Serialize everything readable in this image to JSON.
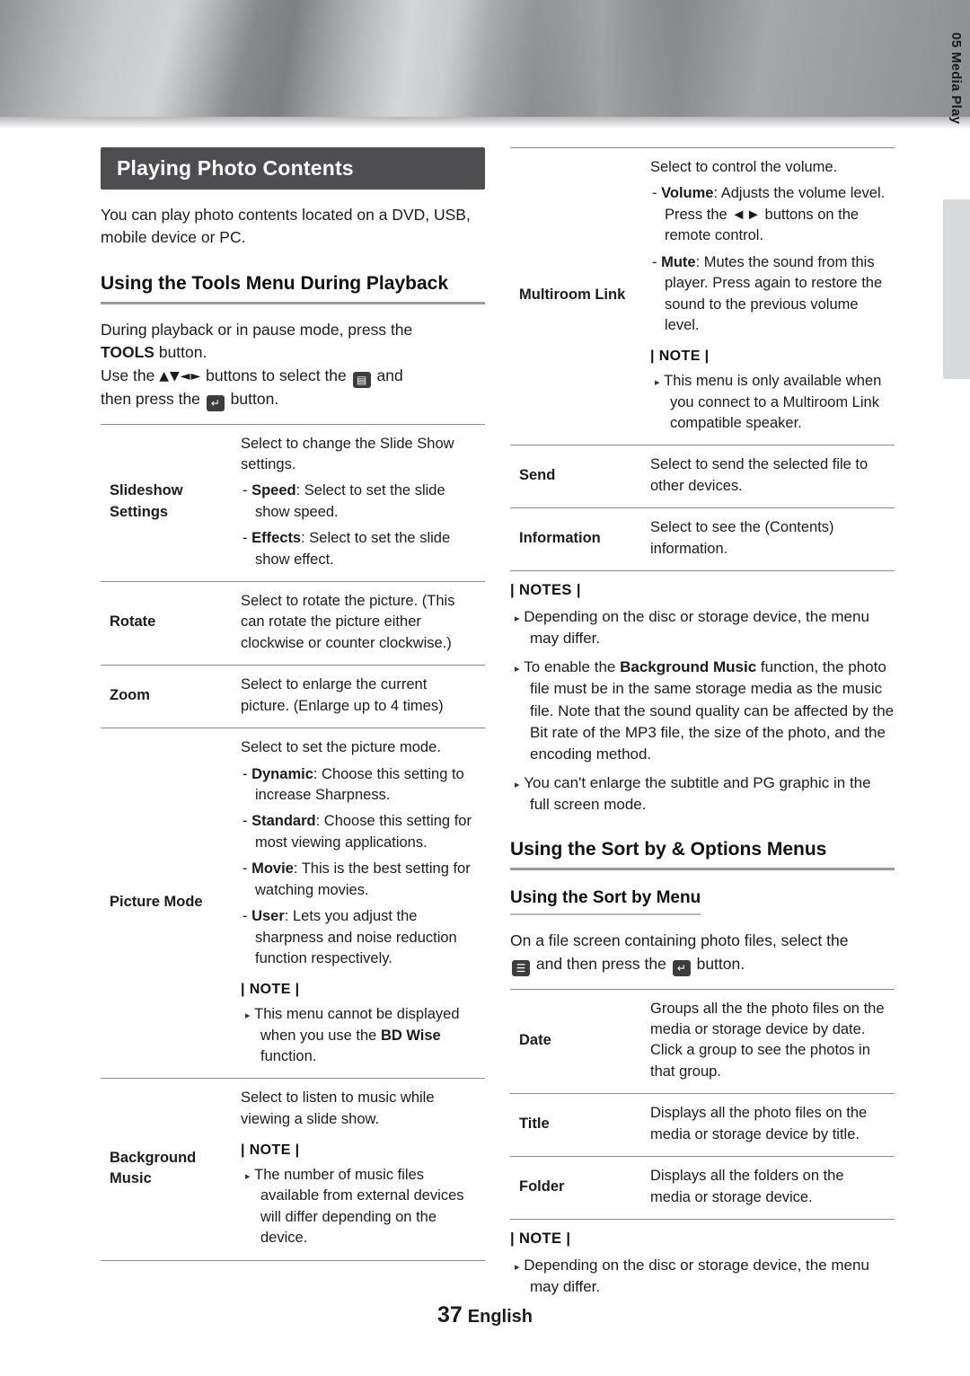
{
  "sidetab": {
    "label": "05   Media Play"
  },
  "left": {
    "title": "Playing Photo Contents",
    "intro": "You can play photo contents located on a DVD, USB, mobile device or PC.",
    "h2": "Using the Tools Menu During Playback",
    "para1_a": "During playback or in pause mode, press the",
    "para1_b": "TOOLS",
    "para1_c": "button.",
    "para2_a": "Use the",
    "para2_arrows": "▲▼◄►",
    "para2_b": "buttons to select the",
    "para2_c": "and",
    "para2_d": "then press the",
    "para2_e": "button",
    "rows": [
      {
        "name": "Slideshow Settings",
        "lead": "Select to change the Slide Show settings.",
        "subs": [
          {
            "kw": "Speed",
            "text": ": Select to set the slide show speed."
          },
          {
            "kw": "Effects",
            "text": ": Select to set the slide show effect."
          }
        ]
      },
      {
        "name": "Rotate",
        "lead": "Select to rotate the picture. (This can rotate the picture either clockwise or counter clockwise.)",
        "subs": []
      },
      {
        "name": "Zoom",
        "lead": "Select to enlarge the current picture. (Enlarge up to 4 times)",
        "subs": []
      },
      {
        "name": "Picture Mode",
        "lead": "Select to set the picture mode.",
        "subs": [
          {
            "kw": "Dynamic",
            "text": ": Choose this setting to increase Sharpness."
          },
          {
            "kw": "Standard",
            "text": ": Choose this setting for most viewing applications."
          },
          {
            "kw": "Movie",
            "text": ": This is the best setting for watching movies."
          },
          {
            "kw": "User",
            "text": ": Lets you adjust the sharpness and noise reduction function respectively."
          }
        ],
        "note_label": "| NOTE |",
        "note_a": "This menu cannot be displayed when you use the",
        "note_kw": "BD Wise",
        "note_b": "function."
      },
      {
        "name": "Background Music",
        "lead": "Select to listen to music while viewing a slide show.",
        "subs": [],
        "note_label": "| NOTE |",
        "note_a": "The number of music files available from external devices will differ depending on the device.",
        "note_kw": "",
        "note_b": ""
      }
    ]
  },
  "right": {
    "rows": [
      {
        "name": "Multiroom Link",
        "lead": "Select to control the volume.",
        "subs": [
          {
            "kw": "Volume",
            "text": ": Adjusts the volume level. Press the ◄► buttons on the remote control."
          },
          {
            "kw": "Mute",
            "text": ": Mutes the sound from this player. Press again to restore the sound to the previous volume level."
          }
        ],
        "note_label": "| NOTE |",
        "note_a": "This menu is only available when you connect to a Multiroom Link compatible speaker."
      },
      {
        "name": "Send",
        "lead": "Select to send the selected file to other devices.",
        "subs": []
      },
      {
        "name": "Information",
        "lead": "Select to see the (Contents) information.",
        "subs": []
      }
    ],
    "notes_label": "| NOTES |",
    "notes": [
      {
        "pre": "Depending on the disc or storage device, the menu may differ.",
        "kw": "",
        "post": ""
      },
      {
        "pre": "To enable the",
        "kw": "Background Music",
        "post": "function, the photo file must be in the same storage media as the music file. Note that the sound quality can be affected by the Bit rate of the MP3 file, the size of the photo, and the encoding method."
      },
      {
        "pre": "You can't enlarge the subtitle and PG graphic in the full screen mode.",
        "kw": "",
        "post": ""
      }
    ],
    "h2": "Using the Sort by & Options Menus",
    "h3": "Using the Sort by Menu",
    "para_a": "On a file screen containing photo files, select the",
    "para_b": "and then press the",
    "para_c": "button.",
    "sort_rows": [
      {
        "name": "Date",
        "lead": "Groups all the the photo files on the media or storage device by date. Click a group to see the photos in that group."
      },
      {
        "name": "Title",
        "lead": "Displays all the photo files on the media or storage device by title."
      },
      {
        "name": "Folder",
        "lead": "Displays all the folders on the media or storage device."
      }
    ],
    "note_label": "| NOTE |",
    "note_text": "Depending on the disc or storage device, the menu may differ."
  },
  "footer": {
    "page": "37",
    "language": "English"
  }
}
